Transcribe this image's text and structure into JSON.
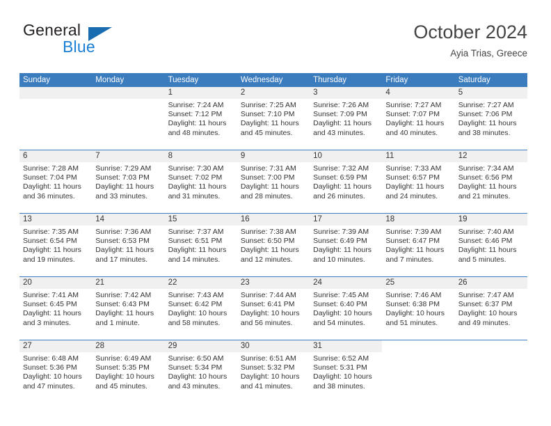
{
  "brand": {
    "name_top": "General",
    "name_bottom": "Blue",
    "accent_color": "#1a7fd4",
    "triangle_color": "#1a6cb0"
  },
  "header": {
    "title": "October 2024",
    "subtitle": "Ayia Trias, Greece",
    "header_bg": "#3a7cbe",
    "daynum_bg": "#f0f0f0"
  },
  "weekdays": [
    "Sunday",
    "Monday",
    "Tuesday",
    "Wednesday",
    "Thursday",
    "Friday",
    "Saturday"
  ],
  "labels": {
    "sunrise": "Sunrise:",
    "sunset": "Sunset:",
    "daylight": "Daylight:"
  },
  "weeks": [
    [
      {
        "day": "",
        "sunrise": "",
        "sunset": "",
        "daylight": "",
        "empty": true
      },
      {
        "day": "",
        "sunrise": "",
        "sunset": "",
        "daylight": "",
        "empty": true
      },
      {
        "day": "1",
        "sunrise": "Sunrise: 7:24 AM",
        "sunset": "Sunset: 7:12 PM",
        "daylight": "Daylight: 11 hours and 48 minutes."
      },
      {
        "day": "2",
        "sunrise": "Sunrise: 7:25 AM",
        "sunset": "Sunset: 7:10 PM",
        "daylight": "Daylight: 11 hours and 45 minutes."
      },
      {
        "day": "3",
        "sunrise": "Sunrise: 7:26 AM",
        "sunset": "Sunset: 7:09 PM",
        "daylight": "Daylight: 11 hours and 43 minutes."
      },
      {
        "day": "4",
        "sunrise": "Sunrise: 7:27 AM",
        "sunset": "Sunset: 7:07 PM",
        "daylight": "Daylight: 11 hours and 40 minutes."
      },
      {
        "day": "5",
        "sunrise": "Sunrise: 7:27 AM",
        "sunset": "Sunset: 7:06 PM",
        "daylight": "Daylight: 11 hours and 38 minutes."
      }
    ],
    [
      {
        "day": "6",
        "sunrise": "Sunrise: 7:28 AM",
        "sunset": "Sunset: 7:04 PM",
        "daylight": "Daylight: 11 hours and 36 minutes."
      },
      {
        "day": "7",
        "sunrise": "Sunrise: 7:29 AM",
        "sunset": "Sunset: 7:03 PM",
        "daylight": "Daylight: 11 hours and 33 minutes."
      },
      {
        "day": "8",
        "sunrise": "Sunrise: 7:30 AM",
        "sunset": "Sunset: 7:02 PM",
        "daylight": "Daylight: 11 hours and 31 minutes."
      },
      {
        "day": "9",
        "sunrise": "Sunrise: 7:31 AM",
        "sunset": "Sunset: 7:00 PM",
        "daylight": "Daylight: 11 hours and 28 minutes."
      },
      {
        "day": "10",
        "sunrise": "Sunrise: 7:32 AM",
        "sunset": "Sunset: 6:59 PM",
        "daylight": "Daylight: 11 hours and 26 minutes."
      },
      {
        "day": "11",
        "sunrise": "Sunrise: 7:33 AM",
        "sunset": "Sunset: 6:57 PM",
        "daylight": "Daylight: 11 hours and 24 minutes."
      },
      {
        "day": "12",
        "sunrise": "Sunrise: 7:34 AM",
        "sunset": "Sunset: 6:56 PM",
        "daylight": "Daylight: 11 hours and 21 minutes."
      }
    ],
    [
      {
        "day": "13",
        "sunrise": "Sunrise: 7:35 AM",
        "sunset": "Sunset: 6:54 PM",
        "daylight": "Daylight: 11 hours and 19 minutes."
      },
      {
        "day": "14",
        "sunrise": "Sunrise: 7:36 AM",
        "sunset": "Sunset: 6:53 PM",
        "daylight": "Daylight: 11 hours and 17 minutes."
      },
      {
        "day": "15",
        "sunrise": "Sunrise: 7:37 AM",
        "sunset": "Sunset: 6:51 PM",
        "daylight": "Daylight: 11 hours and 14 minutes."
      },
      {
        "day": "16",
        "sunrise": "Sunrise: 7:38 AM",
        "sunset": "Sunset: 6:50 PM",
        "daylight": "Daylight: 11 hours and 12 minutes."
      },
      {
        "day": "17",
        "sunrise": "Sunrise: 7:39 AM",
        "sunset": "Sunset: 6:49 PM",
        "daylight": "Daylight: 11 hours and 10 minutes."
      },
      {
        "day": "18",
        "sunrise": "Sunrise: 7:39 AM",
        "sunset": "Sunset: 6:47 PM",
        "daylight": "Daylight: 11 hours and 7 minutes."
      },
      {
        "day": "19",
        "sunrise": "Sunrise: 7:40 AM",
        "sunset": "Sunset: 6:46 PM",
        "daylight": "Daylight: 11 hours and 5 minutes."
      }
    ],
    [
      {
        "day": "20",
        "sunrise": "Sunrise: 7:41 AM",
        "sunset": "Sunset: 6:45 PM",
        "daylight": "Daylight: 11 hours and 3 minutes."
      },
      {
        "day": "21",
        "sunrise": "Sunrise: 7:42 AM",
        "sunset": "Sunset: 6:43 PM",
        "daylight": "Daylight: 11 hours and 1 minute."
      },
      {
        "day": "22",
        "sunrise": "Sunrise: 7:43 AM",
        "sunset": "Sunset: 6:42 PM",
        "daylight": "Daylight: 10 hours and 58 minutes."
      },
      {
        "day": "23",
        "sunrise": "Sunrise: 7:44 AM",
        "sunset": "Sunset: 6:41 PM",
        "daylight": "Daylight: 10 hours and 56 minutes."
      },
      {
        "day": "24",
        "sunrise": "Sunrise: 7:45 AM",
        "sunset": "Sunset: 6:40 PM",
        "daylight": "Daylight: 10 hours and 54 minutes."
      },
      {
        "day": "25",
        "sunrise": "Sunrise: 7:46 AM",
        "sunset": "Sunset: 6:38 PM",
        "daylight": "Daylight: 10 hours and 51 minutes."
      },
      {
        "day": "26",
        "sunrise": "Sunrise: 7:47 AM",
        "sunset": "Sunset: 6:37 PM",
        "daylight": "Daylight: 10 hours and 49 minutes."
      }
    ],
    [
      {
        "day": "27",
        "sunrise": "Sunrise: 6:48 AM",
        "sunset": "Sunset: 5:36 PM",
        "daylight": "Daylight: 10 hours and 47 minutes."
      },
      {
        "day": "28",
        "sunrise": "Sunrise: 6:49 AM",
        "sunset": "Sunset: 5:35 PM",
        "daylight": "Daylight: 10 hours and 45 minutes."
      },
      {
        "day": "29",
        "sunrise": "Sunrise: 6:50 AM",
        "sunset": "Sunset: 5:34 PM",
        "daylight": "Daylight: 10 hours and 43 minutes."
      },
      {
        "day": "30",
        "sunrise": "Sunrise: 6:51 AM",
        "sunset": "Sunset: 5:32 PM",
        "daylight": "Daylight: 10 hours and 41 minutes."
      },
      {
        "day": "31",
        "sunrise": "Sunrise: 6:52 AM",
        "sunset": "Sunset: 5:31 PM",
        "daylight": "Daylight: 10 hours and 38 minutes."
      },
      {
        "day": "",
        "sunrise": "",
        "sunset": "",
        "daylight": "",
        "blank": true
      },
      {
        "day": "",
        "sunrise": "",
        "sunset": "",
        "daylight": "",
        "blank": true
      }
    ]
  ]
}
